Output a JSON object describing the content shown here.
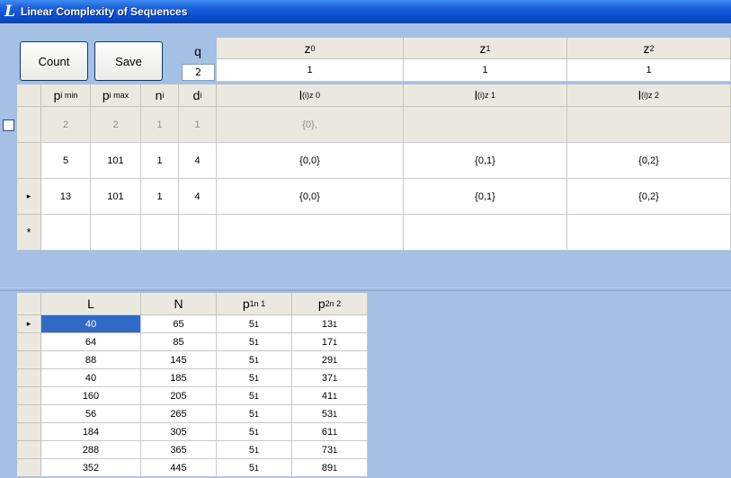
{
  "window": {
    "title": "Linear Complexity of Sequences",
    "app_icon": "L"
  },
  "toolbar": {
    "count_label": "Count",
    "save_label": "Save"
  },
  "q": {
    "label": "q",
    "value": "2"
  },
  "z_headers": [
    {
      "base": "z",
      "sub": "0",
      "value": "1"
    },
    {
      "base": "z",
      "sub": "1",
      "value": "1"
    },
    {
      "base": "z",
      "sub": "2",
      "value": "1"
    }
  ],
  "top_grid": {
    "columns": {
      "pmin": {
        "base": "p",
        "sub": "i min"
      },
      "pmax": {
        "base": "p",
        "sub": "i max"
      },
      "ni": {
        "base": "n",
        "sub": "i"
      },
      "di": {
        "base": "d",
        "sub": "i"
      },
      "l0": {
        "base": "l",
        "sup": "(i)",
        "sub": "z 0"
      },
      "l1": {
        "base": "l",
        "sup": "(i)",
        "sub": "z 1"
      },
      "l2": {
        "base": "l",
        "sup": "(i)",
        "sub": "z 2"
      }
    },
    "rows": [
      {
        "pmin": "2",
        "pmax": "2",
        "ni": "1",
        "di": "1",
        "l0": "{0},",
        "l1": "",
        "l2": ""
      },
      {
        "pmin": "5",
        "pmax": "101",
        "ni": "1",
        "di": "4",
        "l0": "{0,0}",
        "l1": "{0,1}",
        "l2": "{0,2}"
      },
      {
        "pmin": "13",
        "pmax": "101",
        "ni": "1",
        "di": "4",
        "l0": "{0,0}",
        "l1": "{0,1}",
        "l2": "{0,2}"
      }
    ],
    "new_row_marker": "*",
    "current_row_marker": "▸"
  },
  "bottom_grid": {
    "columns": {
      "L": "L",
      "N": "N",
      "p1": {
        "base": "p",
        "sub": "1",
        "sup": "n 1"
      },
      "p2": {
        "base": "p",
        "sub": "2",
        "sup": "n 2"
      }
    },
    "rows": [
      {
        "L": "40",
        "N": "65",
        "p1": "5",
        "p1e": "1",
        "p2": "13",
        "p2e": "1"
      },
      {
        "L": "64",
        "N": "85",
        "p1": "5",
        "p1e": "1",
        "p2": "17",
        "p2e": "1"
      },
      {
        "L": "88",
        "N": "145",
        "p1": "5",
        "p1e": "1",
        "p2": "29",
        "p2e": "1"
      },
      {
        "L": "40",
        "N": "185",
        "p1": "5",
        "p1e": "1",
        "p2": "37",
        "p2e": "1"
      },
      {
        "L": "160",
        "N": "205",
        "p1": "5",
        "p1e": "1",
        "p2": "41",
        "p2e": "1"
      },
      {
        "L": "56",
        "N": "265",
        "p1": "5",
        "p1e": "1",
        "p2": "53",
        "p2e": "1"
      },
      {
        "L": "184",
        "N": "305",
        "p1": "5",
        "p1e": "1",
        "p2": "61",
        "p2e": "1"
      },
      {
        "L": "288",
        "N": "365",
        "p1": "5",
        "p1e": "1",
        "p2": "73",
        "p2e": "1"
      },
      {
        "L": "352",
        "N": "445",
        "p1": "5",
        "p1e": "1",
        "p2": "89",
        "p2e": "1"
      }
    ],
    "current_row_marker": "▸"
  },
  "colors": {
    "titlebar": "#0a4fd0",
    "background": "#a5c0e5",
    "grid_header": "#ebe9df",
    "selection": "#316ac5"
  }
}
